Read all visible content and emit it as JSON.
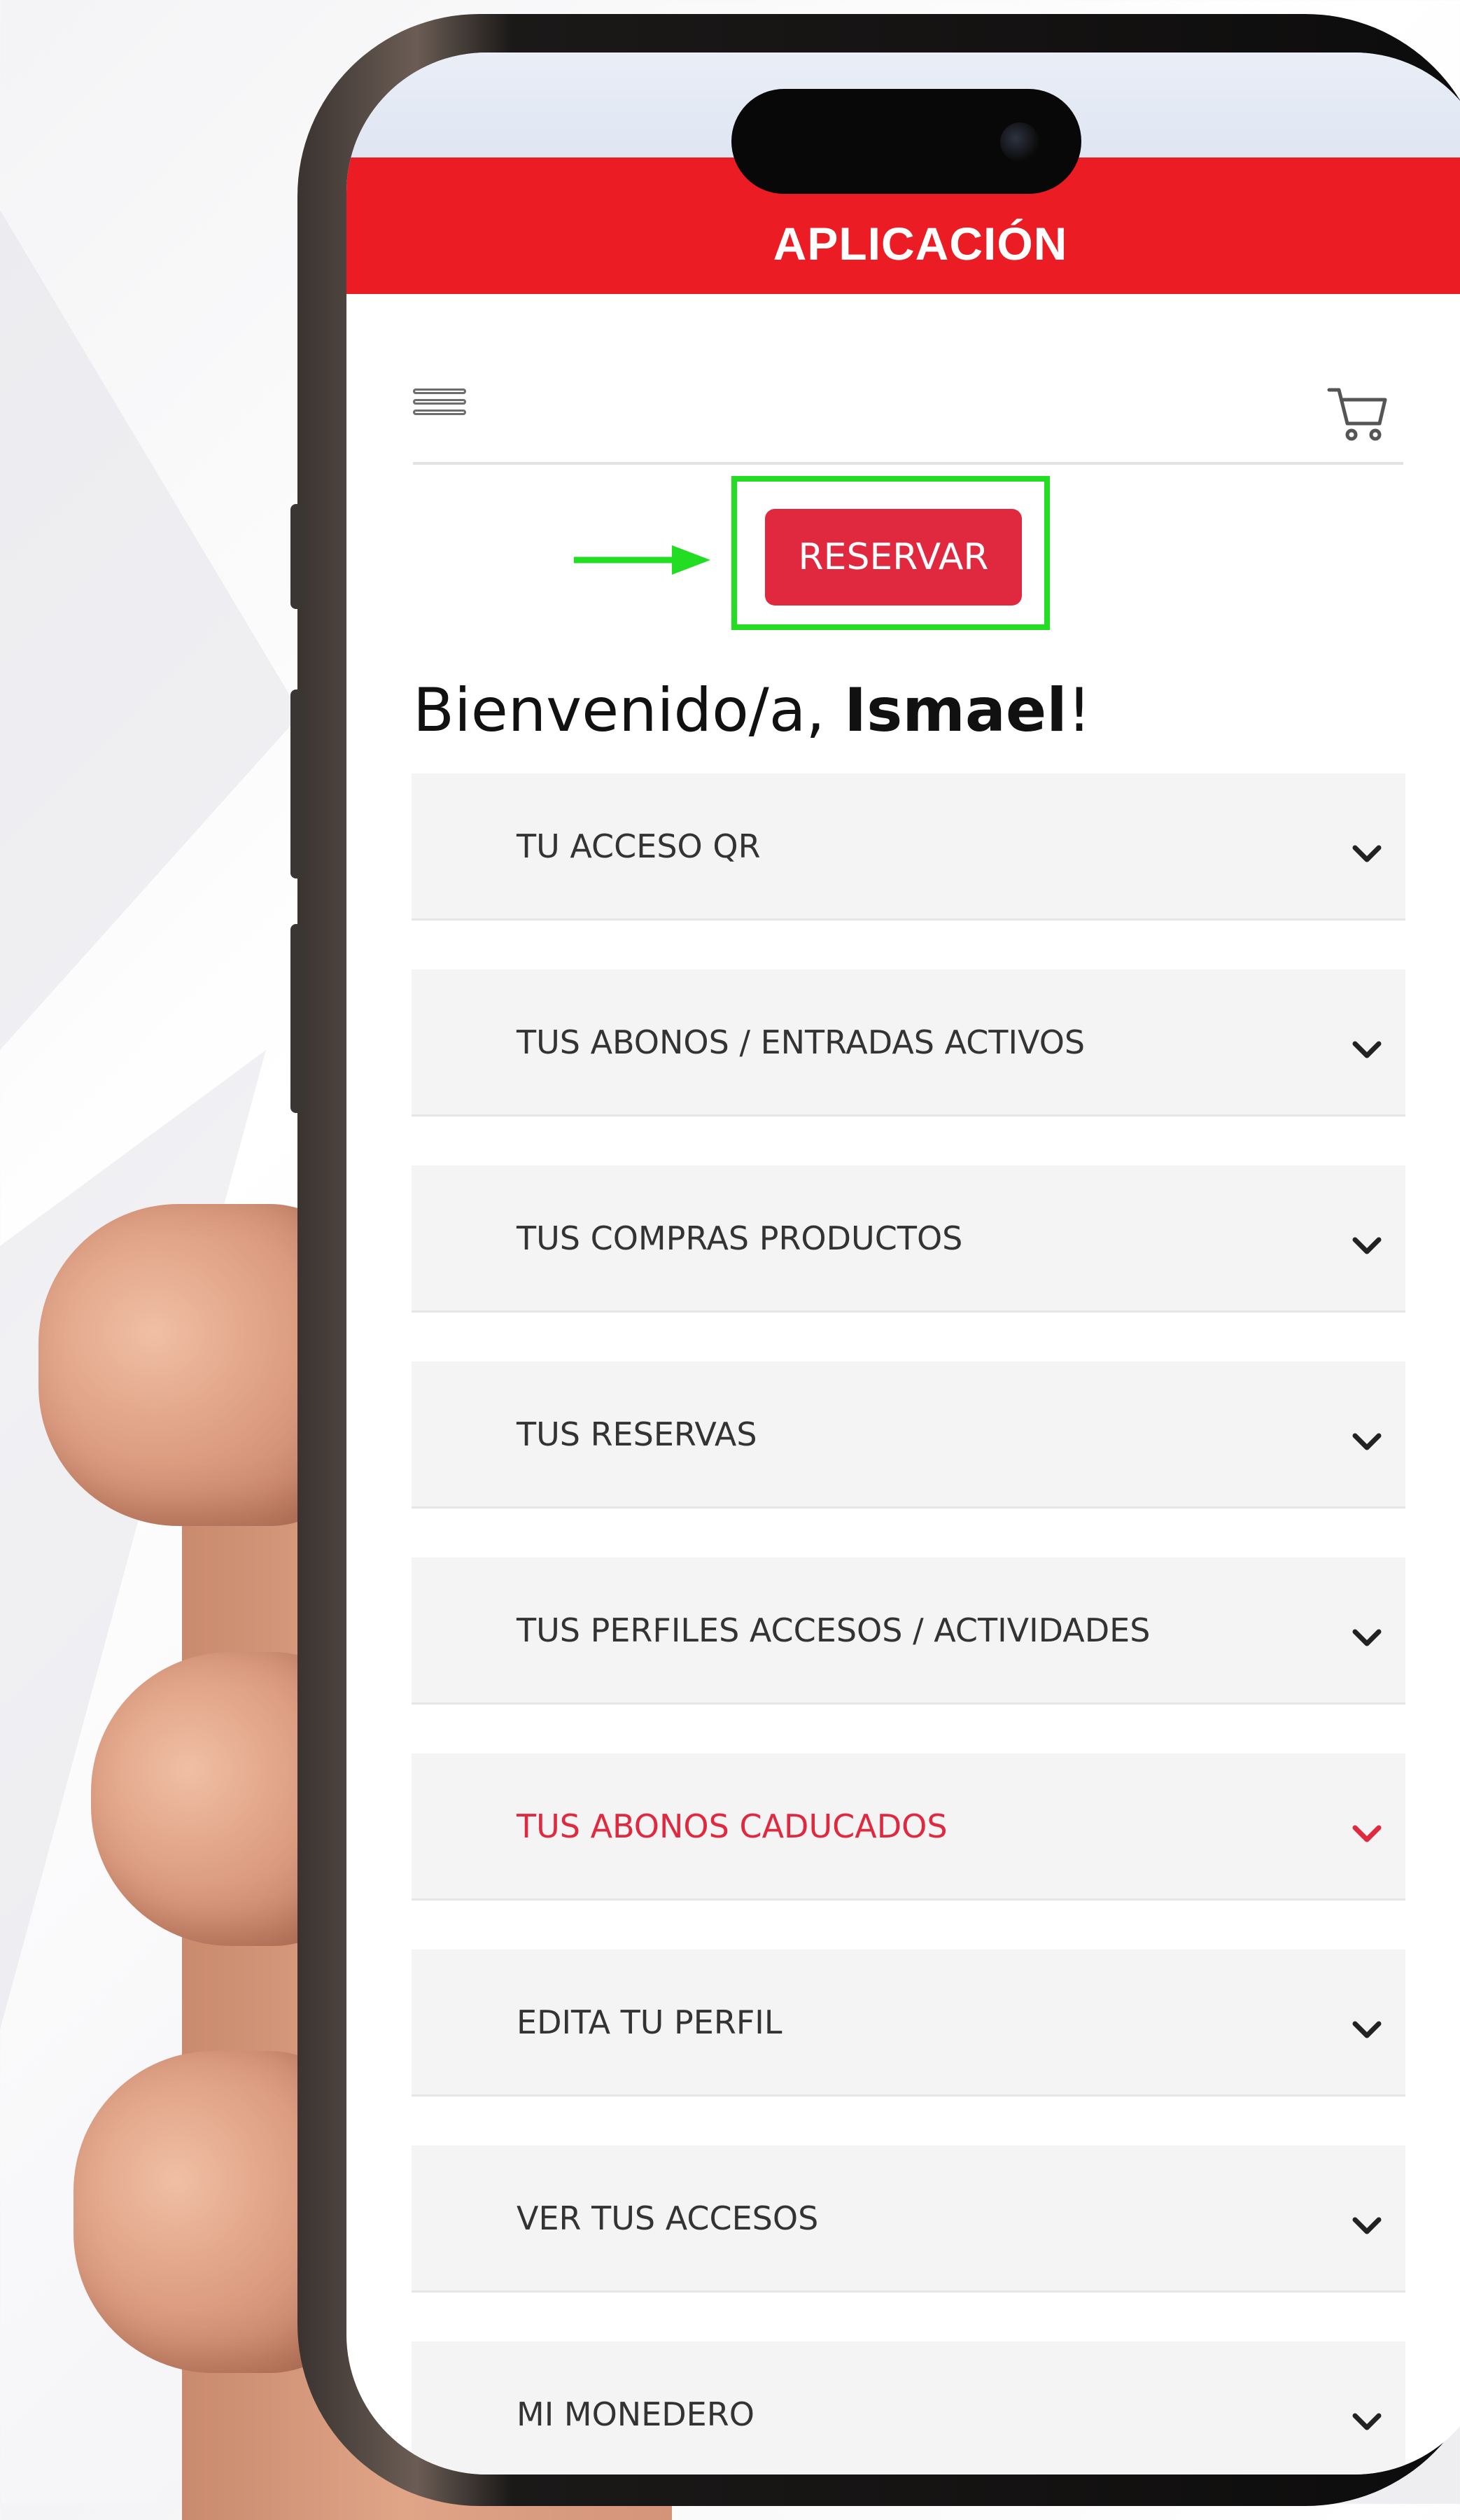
{
  "app": {
    "title": "APLICACIÓN"
  },
  "header": {
    "menu_icon": "hamburger-menu-icon",
    "cart_icon": "shopping-cart-icon"
  },
  "reserve_button": {
    "label": "RESERVAR",
    "highlight_color": "#22dd22",
    "color": "#e0283f"
  },
  "welcome": {
    "prefix": "Bienvenido/a, ",
    "name": "Ismael",
    "suffix": "!"
  },
  "accordion": [
    {
      "label": "TU ACCESO QR",
      "state": "collapsed"
    },
    {
      "label": "TUS ABONOS / ENTRADAS ACTIVOS",
      "state": "collapsed"
    },
    {
      "label": "TUS COMPRAS PRODUCTOS",
      "state": "collapsed"
    },
    {
      "label": "TUS RESERVAS",
      "state": "collapsed"
    },
    {
      "label": "TUS PERFILES ACCESOS / ACTIVIDADES",
      "state": "collapsed"
    },
    {
      "label": "TUS ABONOS CADUCADOS",
      "state": "collapsed",
      "accent": "#e0283f"
    },
    {
      "label": "EDITA TU PERFIL",
      "state": "collapsed"
    },
    {
      "label": "VER TUS ACCESOS",
      "state": "collapsed"
    },
    {
      "label": "MI MONEDERO",
      "state": "collapsed"
    }
  ],
  "colors": {
    "brand_red": "#ec1c24",
    "panel_bg": "#f4f4f4"
  }
}
